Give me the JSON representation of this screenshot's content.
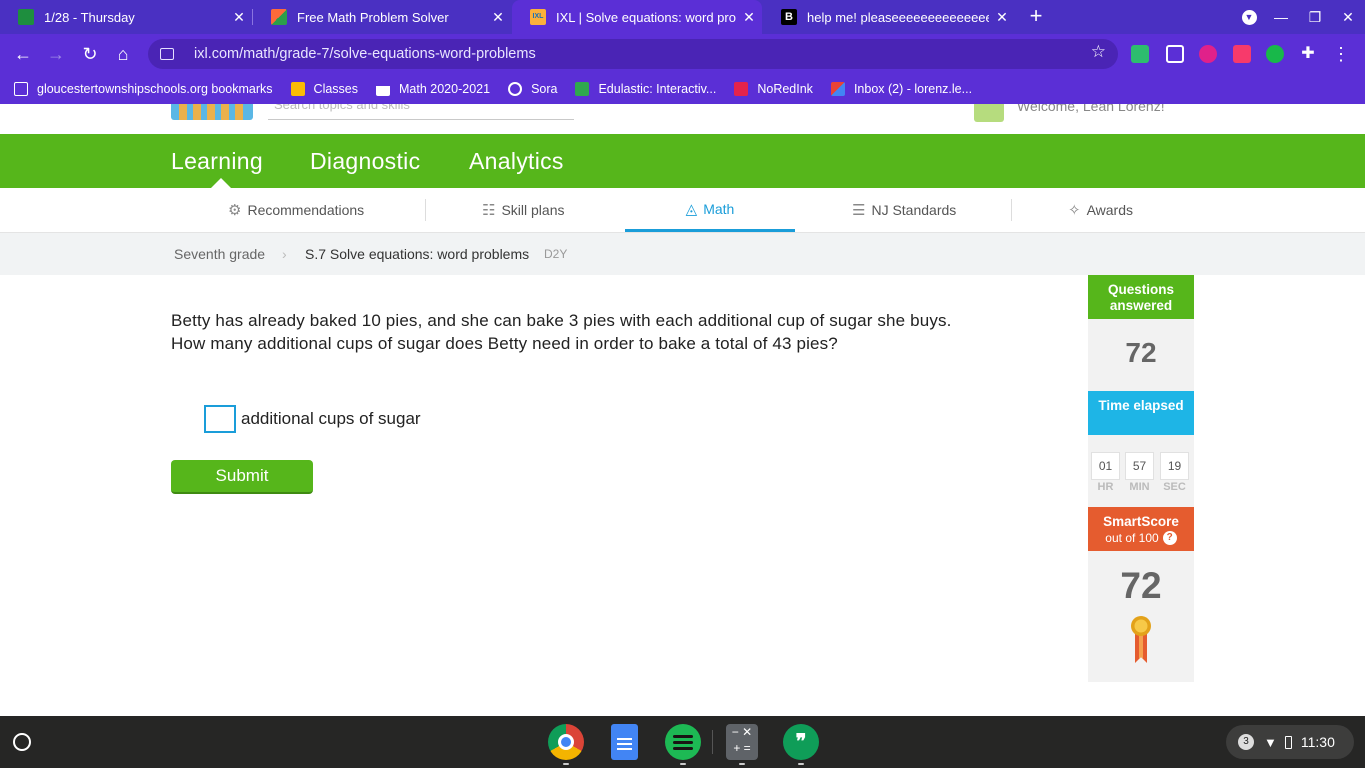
{
  "tabs": [
    {
      "title": "1/28 - Thursday",
      "icon": "google-classroom-icon",
      "color": "#1e8e3e",
      "active": false
    },
    {
      "title": "Free Math Problem Solver",
      "icon": "math-solver-icon",
      "color": "#ff6a39",
      "active": false
    },
    {
      "title": "IXL | Solve equations: word probl",
      "icon": "ixl-icon",
      "color": "#fbb03b",
      "active": true
    },
    {
      "title": "help me! pleaseeeeeeeeeeeeeee",
      "icon": "brainly-icon",
      "color": "#000000",
      "active": false
    }
  ],
  "toolbar": {
    "url": "ixl.com/math/grade-7/solve-equations-word-problems"
  },
  "bookmarks": [
    {
      "label": "gloucestertownshipschools.org bookmarks",
      "icon": "folder-icon"
    },
    {
      "label": "Classes",
      "icon": "classroom-icon"
    },
    {
      "label": "Math 2020-2021",
      "icon": "classroom-icon"
    },
    {
      "label": "Sora",
      "icon": "sora-icon"
    },
    {
      "label": "Edulastic: Interactiv...",
      "icon": "edulastic-icon"
    },
    {
      "label": "NoRedInk",
      "icon": "noredink-icon"
    },
    {
      "label": "Inbox (2) - lorenz.le...",
      "icon": "gmail-icon"
    }
  ],
  "header": {
    "search_placeholder": "Search topics and skills",
    "welcome": "Welcome, Leah Lorenz!"
  },
  "main_nav": [
    "Learning",
    "Diagnostic",
    "Analytics"
  ],
  "sub_nav": [
    {
      "label": "Recommendations",
      "icon": "recommendations-icon"
    },
    {
      "label": "Skill plans",
      "icon": "skill-plans-icon"
    },
    {
      "label": "Math",
      "icon": "math-icon"
    },
    {
      "label": "NJ Standards",
      "icon": "standards-icon"
    },
    {
      "label": "Awards",
      "icon": "awards-icon"
    }
  ],
  "breadcrumb": {
    "grade": "Seventh grade",
    "skill": "S.7 Solve equations: word problems",
    "code": "D2Y"
  },
  "question": {
    "text": "Betty has already baked 10 pies, and she can bake 3 pies with each additional cup of sugar she buys. How many additional cups of sugar does Betty need in order to bake a total of 43 pies?",
    "answer_value": "",
    "answer_label": "additional cups of sugar",
    "submit_label": "Submit"
  },
  "stats": {
    "questions_answered_label": "Questions answered",
    "questions_answered": "72",
    "time_elapsed_label": "Time elapsed",
    "hr": "01",
    "min": "57",
    "sec": "19",
    "hr_label": "HR",
    "min_label": "MIN",
    "sec_label": "SEC",
    "smartscore_label": "SmartScore",
    "smartscore_sub": "out of 100",
    "help_mark": "?",
    "smartscore": "72"
  },
  "shelf": {
    "apps": [
      "chrome-icon",
      "docs-icon",
      "spotify-icon",
      "calculator-icon",
      "hangouts-icon"
    ],
    "notification_count": "3",
    "time": "11:30"
  },
  "colors": {
    "chrome_purple": "#5b2fd6",
    "ixl_green": "#56b61b",
    "ixl_blue": "#1eb5e6",
    "ixl_orange": "#e55c2f"
  }
}
